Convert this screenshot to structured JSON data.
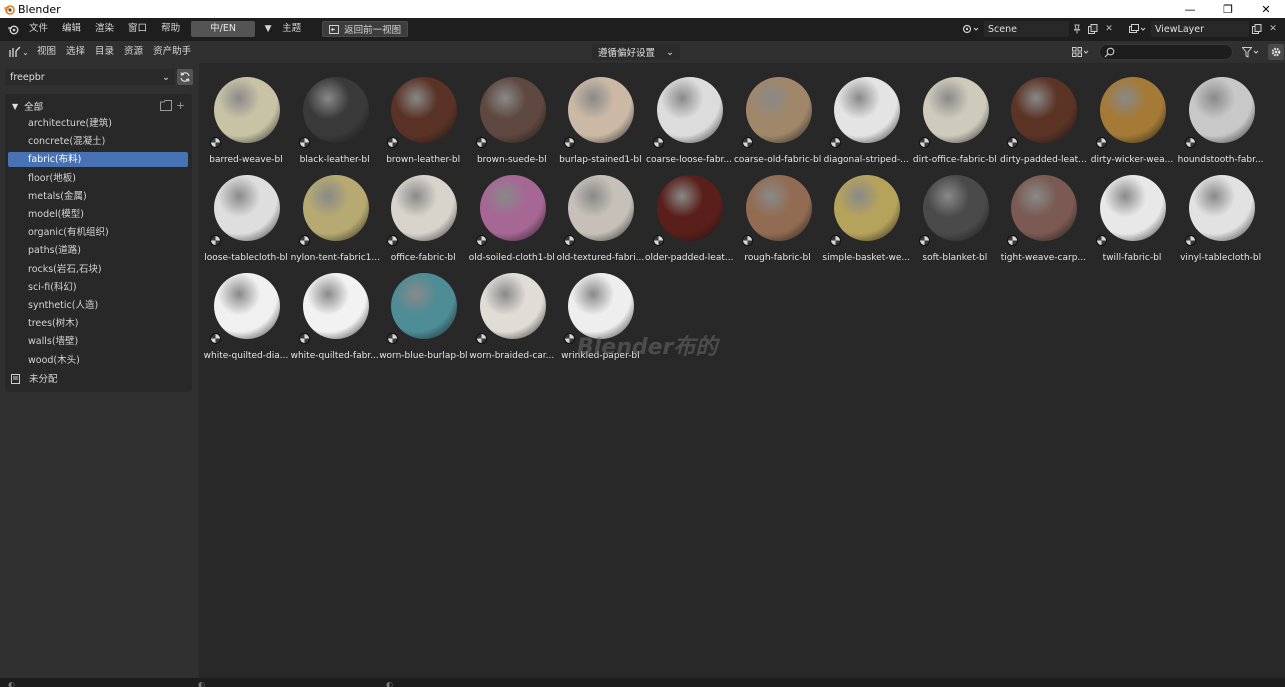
{
  "window": {
    "title": "Blender",
    "controls": [
      "—",
      "❐",
      "✕"
    ]
  },
  "topbar": {
    "menus": [
      "文件",
      "编辑",
      "渲染",
      "窗口",
      "帮助"
    ],
    "lang_button": "中/EN",
    "theme_menu": "主题",
    "back_button": "返回前一视图",
    "scene": "Scene",
    "view_layer": "ViewLayer"
  },
  "header": {
    "menus": [
      "视图",
      "选择",
      "目录",
      "资源",
      "资产助手"
    ],
    "dropdown": "遵循偏好设置",
    "search_placeholder": ""
  },
  "sidebar": {
    "library": "freepbr",
    "root": "全部",
    "categories": [
      "architecture(建筑)",
      "concrete(混凝土)",
      "fabric(布料)",
      "floor(地板)",
      "metals(金属)",
      "model(模型)",
      "organic(有机组织)",
      "paths(道路)",
      "rocks(岩石,石块)",
      "sci-fi(科幻)",
      "synthetic(人造)",
      "trees(树木)",
      "walls(墙壁)",
      "wood(木头)"
    ],
    "active_index": 2,
    "unassigned": "未分配"
  },
  "assets": [
    {
      "label": "barred-weave-bl",
      "color": "#c9c3a6"
    },
    {
      "label": "black-leather-bl",
      "color": "#3a3a3a"
    },
    {
      "label": "brown-leather-bl",
      "color": "#5a3326"
    },
    {
      "label": "brown-suede-bl",
      "color": "#5e4840"
    },
    {
      "label": "burlap-stained1-bl",
      "color": "#cbb9a6"
    },
    {
      "label": "coarse-loose-fabr...",
      "color": "#dcdcdc"
    },
    {
      "label": "coarse-old-fabric-bl",
      "color": "#a0876a"
    },
    {
      "label": "diagonal-striped-...",
      "color": "#e4e4e4"
    },
    {
      "label": "dirt-office-fabric-bl",
      "color": "#cfcbbc"
    },
    {
      "label": "dirty-padded-leat...",
      "color": "#5c3426"
    },
    {
      "label": "dirty-wicker-wea...",
      "color": "#a47a36"
    },
    {
      "label": "houndstooth-fabr...",
      "color": "#c8c8c8"
    },
    {
      "label": "loose-tablecloth-bl",
      "color": "#dedede"
    },
    {
      "label": "nylon-tent-fabric1...",
      "color": "#b6aa72"
    },
    {
      "label": "office-fabric-bl",
      "color": "#d8d4cc"
    },
    {
      "label": "old-soiled-cloth1-bl",
      "color": "#a66795"
    },
    {
      "label": "old-textured-fabri...",
      "color": "#c6c0b8"
    },
    {
      "label": "older-padded-leat...",
      "color": "#5a1f1a"
    },
    {
      "label": "rough-fabric-bl",
      "color": "#926c52"
    },
    {
      "label": "simple-basket-we...",
      "color": "#b5a35c"
    },
    {
      "label": "soft-blanket-bl",
      "color": "#4a4a4a"
    },
    {
      "label": "tight-weave-carp...",
      "color": "#7a5a52"
    },
    {
      "label": "twill-fabric-bl",
      "color": "#e8e8e8"
    },
    {
      "label": "vinyl-tablecloth-bl",
      "color": "#e2e2e2"
    },
    {
      "label": "white-quilted-dia...",
      "color": "#f0f0f0"
    },
    {
      "label": "white-quilted-fabr...",
      "color": "#f2f2f2"
    },
    {
      "label": "worn-blue-burlap-bl",
      "color": "#4e8c96"
    },
    {
      "label": "worn-braided-car...",
      "color": "#e0dcd6"
    },
    {
      "label": "wrinkled-paper-bl",
      "color": "#eeeeee"
    }
  ],
  "watermark": "Blender布的"
}
